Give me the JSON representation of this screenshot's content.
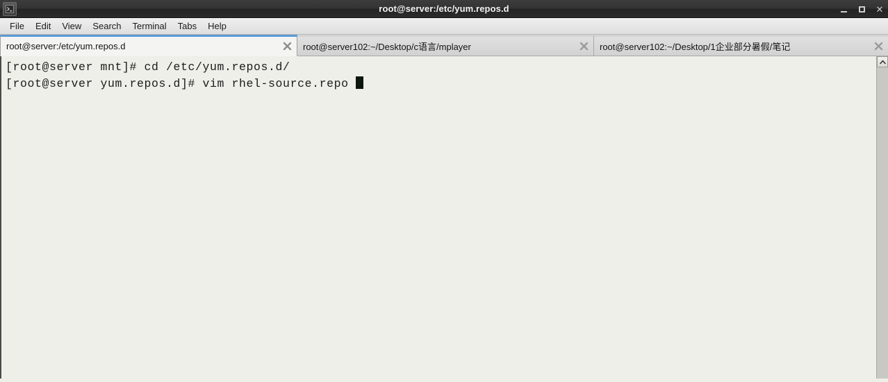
{
  "window": {
    "title": "root@server:/etc/yum.repos.d",
    "icon": "terminal-icon",
    "controls": {
      "minimize": "minimize",
      "maximize": "maximize",
      "close": "✕"
    }
  },
  "menubar": {
    "items": [
      {
        "label": "File"
      },
      {
        "label": "Edit"
      },
      {
        "label": "View"
      },
      {
        "label": "Search"
      },
      {
        "label": "Terminal"
      },
      {
        "label": "Tabs"
      },
      {
        "label": "Help"
      }
    ]
  },
  "tabs": [
    {
      "label": "root@server:/etc/yum.repos.d",
      "active": true,
      "close": "close-icon"
    },
    {
      "label": "root@server102:~/Desktop/c语言/mplayer",
      "active": false,
      "close": "close-icon"
    },
    {
      "label": "root@server102:~/Desktop/1企业部分暑假/笔记",
      "active": false,
      "close": "close-icon"
    }
  ],
  "terminal": {
    "lines": [
      "[root@server mnt]# cd /etc/yum.repos.d/",
      "[root@server yum.repos.d]# vim rhel-source.repo "
    ],
    "background_color": "#EFEFE9",
    "foreground_color": "#1b1b1b",
    "cursor_color": "#0d160d"
  },
  "scrollbar": {
    "up_arrow": "chevron-up-icon"
  },
  "colors": {
    "titlebar": "#2f2f2f",
    "active_tab_accent": "#5a9ad6",
    "menubar": "#e6e6e6"
  }
}
